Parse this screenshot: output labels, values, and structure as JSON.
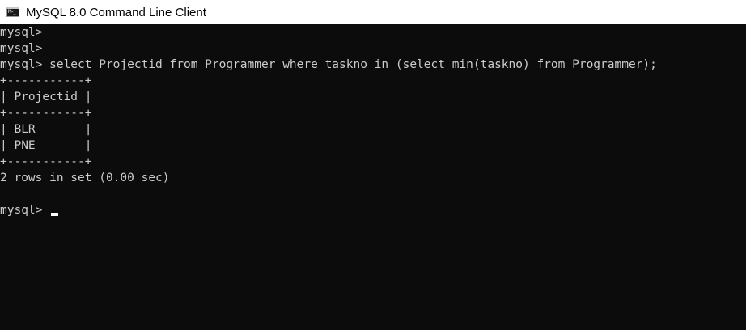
{
  "window": {
    "title": "MySQL 8.0 Command Line Client",
    "icon": "console-window-icon",
    "icon_glyph": "M>_"
  },
  "console": {
    "lines": [
      "mysql>",
      "mysql>",
      "mysql> select Projectid from Programmer where taskno in (select min(taskno) from Programmer);",
      "+-----------+",
      "| Projectid |",
      "+-----------+",
      "| BLR       |",
      "| PNE       |",
      "+-----------+",
      "2 rows in set (0.00 sec)",
      "",
      "mysql> "
    ]
  },
  "colors": {
    "background": "#0c0c0c",
    "text": "#cccccc",
    "titlebar": "#ffffff",
    "cursor": "#ffffff"
  }
}
